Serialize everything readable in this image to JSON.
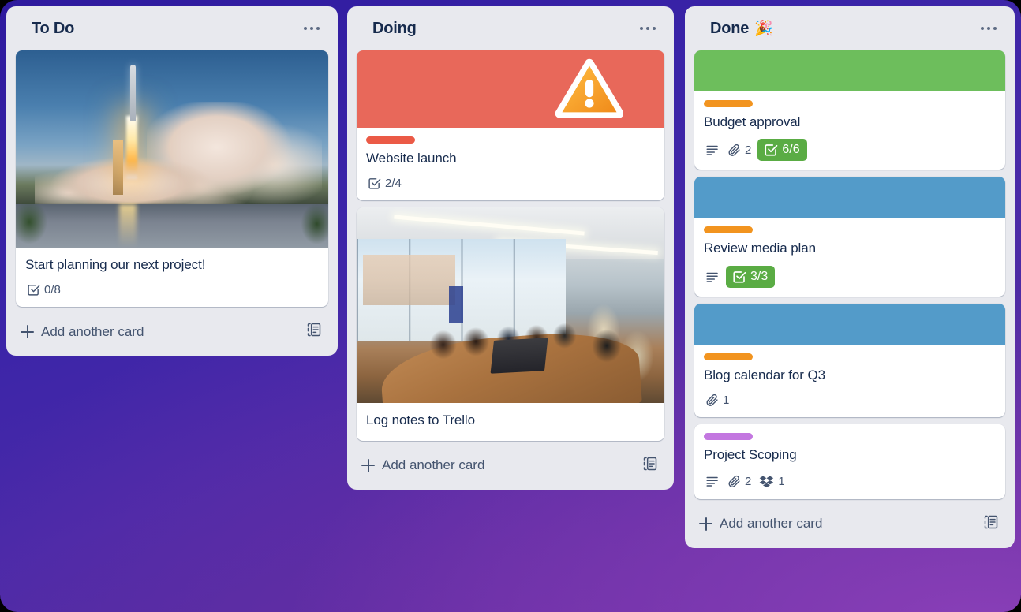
{
  "board": {
    "background_colors": [
      "#2e1a9e",
      "#3a24a8",
      "#5b2d96",
      "#8a3fb8"
    ],
    "lists": [
      {
        "id": "todo",
        "title": "To Do",
        "emoji": "",
        "menu_icon": "ellipsis-icon",
        "add_card_label": "Add another card",
        "card_template_icon": "card-template-icon",
        "cards": [
          {
            "id": "start-planning",
            "title": "Start planning our next project!",
            "cover": {
              "type": "image",
              "name": "rocket-launch-photo"
            },
            "labels": [],
            "badges": [
              {
                "type": "checklist",
                "icon": "checklist-icon",
                "text": "0/8",
                "complete": false
              }
            ]
          }
        ]
      },
      {
        "id": "doing",
        "title": "Doing",
        "emoji": "",
        "menu_icon": "ellipsis-icon",
        "add_card_label": "Add another card",
        "card_template_icon": "card-template-icon",
        "cards": [
          {
            "id": "website-launch",
            "title": "Website launch",
            "cover": {
              "type": "color",
              "color": "#e8685a",
              "sticker": "warning-sign-emoji"
            },
            "labels": [
              {
                "color": "#eb5a46",
                "name": "red-label"
              }
            ],
            "badges": [
              {
                "type": "checklist",
                "icon": "checklist-icon",
                "text": "2/4",
                "complete": false
              }
            ]
          },
          {
            "id": "log-notes",
            "title": "Log notes to Trello",
            "cover": {
              "type": "image",
              "name": "conference-room-meeting-photo"
            },
            "labels": [],
            "badges": []
          }
        ]
      },
      {
        "id": "done",
        "title": "Done",
        "emoji": "🎉",
        "menu_icon": "ellipsis-icon",
        "add_card_label": "Add another card",
        "card_template_icon": "card-template-icon",
        "cards": [
          {
            "id": "budget-approval",
            "title": "Budget approval",
            "cover": {
              "type": "color",
              "color": "#6dbe5c"
            },
            "labels": [
              {
                "color": "#f2941f",
                "name": "orange-label"
              }
            ],
            "badges": [
              {
                "type": "description",
                "icon": "description-icon",
                "text": ""
              },
              {
                "type": "attachment",
                "icon": "attachment-icon",
                "text": "2"
              },
              {
                "type": "checklist",
                "icon": "checklist-icon",
                "text": "6/6",
                "complete": true
              }
            ]
          },
          {
            "id": "review-media-plan",
            "title": "Review media plan",
            "cover": {
              "type": "color",
              "color": "#539bc9"
            },
            "labels": [
              {
                "color": "#f2941f",
                "name": "orange-label"
              }
            ],
            "badges": [
              {
                "type": "description",
                "icon": "description-icon",
                "text": ""
              },
              {
                "type": "checklist",
                "icon": "checklist-icon",
                "text": "3/3",
                "complete": true
              }
            ]
          },
          {
            "id": "blog-calendar-q3",
            "title": "Blog calendar for Q3",
            "cover": {
              "type": "color",
              "color": "#539bc9"
            },
            "labels": [
              {
                "color": "#f2941f",
                "name": "orange-label"
              }
            ],
            "badges": [
              {
                "type": "attachment",
                "icon": "attachment-icon",
                "text": "1"
              }
            ]
          },
          {
            "id": "project-scoping",
            "title": "Project Scoping",
            "cover": null,
            "labels": [
              {
                "color": "#c377e0",
                "name": "purple-label"
              }
            ],
            "badges": [
              {
                "type": "description",
                "icon": "description-icon",
                "text": ""
              },
              {
                "type": "attachment",
                "icon": "attachment-icon",
                "text": "2"
              },
              {
                "type": "dropbox",
                "icon": "dropbox-icon",
                "text": "1"
              }
            ]
          }
        ]
      }
    ]
  }
}
